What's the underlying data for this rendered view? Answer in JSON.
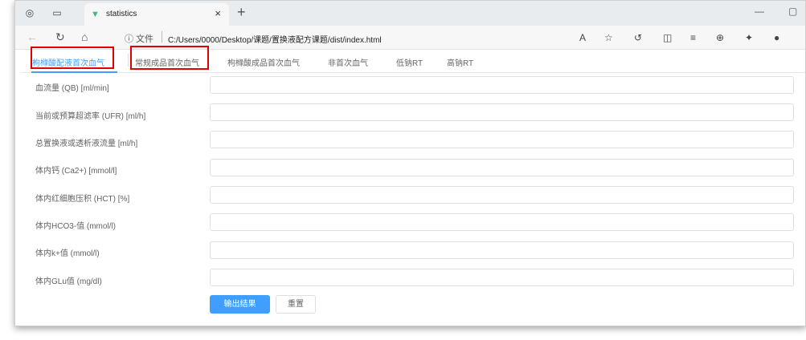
{
  "browser": {
    "tab_title": "statistics",
    "tab_close": "×",
    "new_tab": "+",
    "minimize": "—",
    "restore": "▢",
    "url_info": "ⓘ 文件",
    "url": "C:/Users/0000/Desktop/课题/置换液配方课题/dist/index.html"
  },
  "app": {
    "tabs": [
      {
        "label": "枸橼酸配液首次血气"
      },
      {
        "label": "常规成品首次血气"
      },
      {
        "label": "枸橼酸成品首次血气"
      },
      {
        "label": "非首次血气"
      },
      {
        "label": "低钠RT"
      },
      {
        "label": "高钠RT"
      }
    ],
    "fields": [
      {
        "label": "血流量 (QB) [ml/min]"
      },
      {
        "label": "当前或预算超滤率 (UFR) [ml/h]"
      },
      {
        "label": "总置换液或透析液流量 [ml/h]"
      },
      {
        "label": "体内钙 (Ca2+) [mmol/l]"
      },
      {
        "label": "体内红细胞压积 (HCT) [%]"
      },
      {
        "label": "体内HCO3-值 (mmol/l)"
      },
      {
        "label": "体内k+值 (mmol/l)"
      },
      {
        "label": "体内GLu值 (mg/dl)"
      }
    ],
    "submit_label": "输出结果",
    "reset_label": "重置"
  },
  "colors": {
    "accent": "#409eff",
    "highlight_box": "#e00000"
  }
}
